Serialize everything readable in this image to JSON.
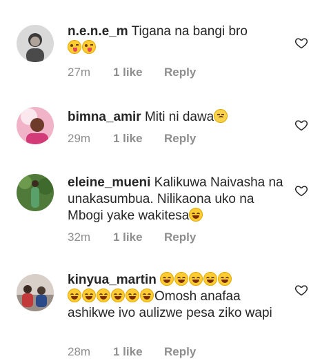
{
  "comments": [
    {
      "username": "n.e.n.e_m",
      "text": "Tigana na bangi bro",
      "emojis": [
        "tongue",
        "tongue"
      ],
      "time": "27m",
      "likes": "1 like",
      "reply": "Reply"
    },
    {
      "username": "bimna_amir",
      "text": "Miti ni dawa",
      "emojis": [
        "sick"
      ],
      "time": "29m",
      "likes": "1 like",
      "reply": "Reply"
    },
    {
      "username": "eleine_mueni",
      "text": "Kalikuwa Naivasha na unakasumbua. Nilikaona uko na Mbogi yake wakitesa",
      "emojis": [
        "joy"
      ],
      "time": "32m",
      "likes": "1 like",
      "reply": "Reply"
    },
    {
      "username": "kinyua_martin",
      "text": "Omosh anafaa ashikwe ivo aulizwe pesa ziko wapi",
      "emojis": [
        "joy",
        "joy",
        "joy",
        "joy",
        "joy",
        "joy",
        "joy",
        "joy",
        "joy",
        "joy",
        "joy"
      ],
      "time": "28m",
      "likes": "1 like",
      "reply": "Reply"
    }
  ],
  "icons": {
    "like": "heart-outline-icon",
    "emoji_tongue": "winking-face-with-tongue",
    "emoji_sick": "sick-face",
    "emoji_joy": "face-with-tears-of-joy"
  }
}
